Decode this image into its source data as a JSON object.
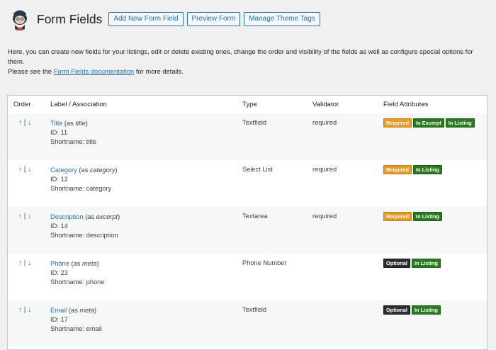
{
  "header": {
    "title": "Form Fields",
    "buttons": [
      "Add New Form Field",
      "Preview Form",
      "Manage Theme Tags"
    ]
  },
  "intro": {
    "line1": "Here, you can create new fields for your listings, edit or delete existing ones, change the order and visibility of the fields as well as configure special options for them.",
    "line2_prefix": "Please see the ",
    "line2_link": "Form Fields documentation",
    "line2_suffix": " for more details."
  },
  "table": {
    "columns": [
      "Order",
      "Label / Association",
      "Type",
      "Validator",
      "Field Attributes"
    ],
    "order_up": "↑",
    "order_sep": "|",
    "order_down": "↓",
    "rows": [
      {
        "name": "Title",
        "assoc_prefix": " (as ",
        "assoc": "title",
        "assoc_suffix": ")",
        "id": "ID: 11",
        "short": "Shortname: title",
        "type": "Textfield",
        "validator": "required",
        "badges": [
          "Required",
          "In Excerpt",
          "In Listing"
        ]
      },
      {
        "name": "Category",
        "assoc_prefix": " (as ",
        "assoc": "category",
        "assoc_suffix": ")",
        "id": "ID: 12",
        "short": "Shortname: category",
        "type": "Select List",
        "validator": "required",
        "badges": [
          "Required",
          "In Listing"
        ]
      },
      {
        "name": "Description",
        "assoc_prefix": " (as ",
        "assoc": "excerpt",
        "assoc_suffix": ")",
        "id": "ID: 14",
        "short": "Shortname: description",
        "type": "Textarea",
        "validator": "required",
        "badges": [
          "Required",
          "In Listing"
        ]
      },
      {
        "name": "Phone",
        "assoc_prefix": " (as ",
        "assoc": "meta",
        "assoc_suffix": ")",
        "id": "ID: 23",
        "short": "Shortname: phone",
        "type": "Phone Number",
        "validator": "",
        "badges": [
          "Optional",
          "In Listing"
        ]
      },
      {
        "name": "Email",
        "assoc_prefix": " (as ",
        "assoc": "meta",
        "assoc_suffix": ")",
        "id": "ID: 17",
        "short": "Shortname: email",
        "type": "Textfield",
        "validator": "",
        "badges": [
          "Optional",
          "In Listing"
        ]
      }
    ]
  },
  "colors": {
    "accent": "#2271b1",
    "required": "#e39c2c",
    "optional": "#2c2f33",
    "listing": "#2a7a1f"
  }
}
